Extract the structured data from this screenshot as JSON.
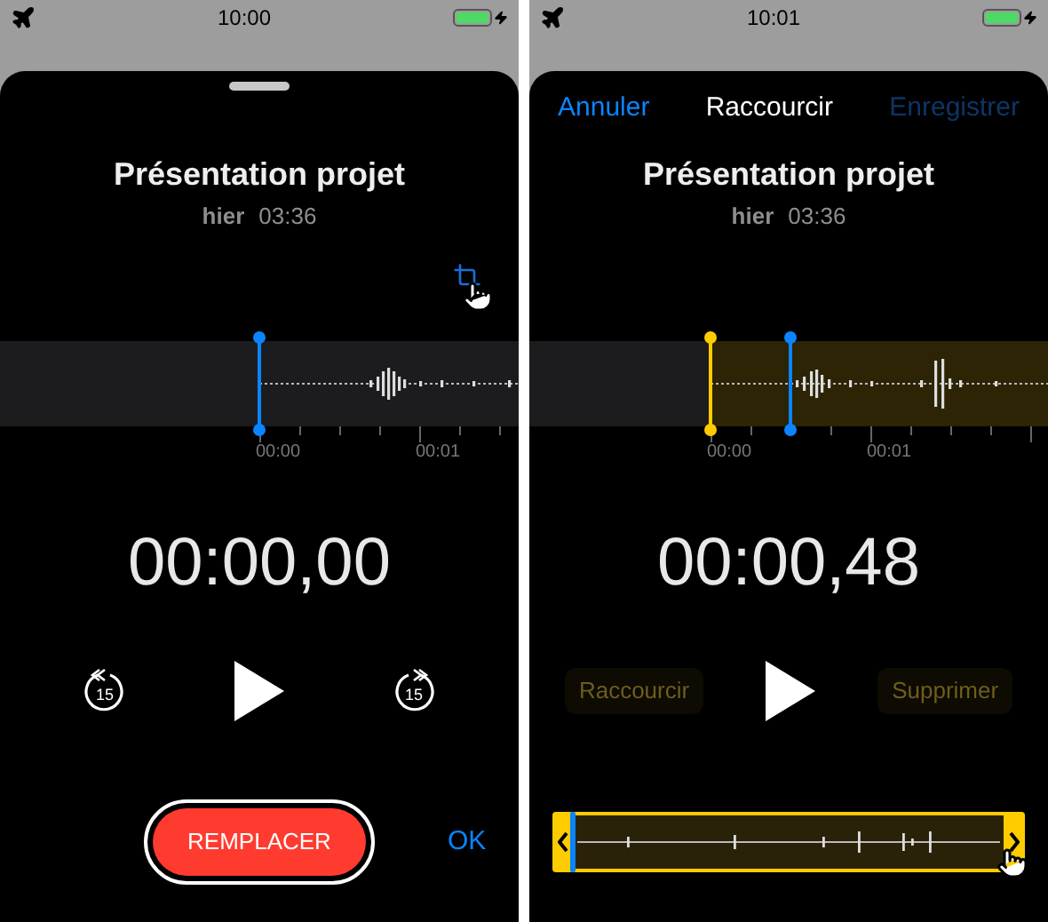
{
  "screens": [
    {
      "kind": "playback",
      "status_bar": {
        "time": "10:00"
      },
      "recording": {
        "title": "Présentation projet",
        "date": "hier",
        "duration": "03:36"
      },
      "timeline": {
        "labels": [
          "00:00",
          "00:01"
        ]
      },
      "timer": "00:00,00",
      "controls": {
        "skip_back": "15",
        "skip_forward": "15"
      },
      "footer": {
        "record_button": "REMPLACER",
        "done": "OK"
      }
    },
    {
      "kind": "trim",
      "status_bar": {
        "time": "10:01"
      },
      "nav": {
        "cancel": "Annuler",
        "title": "Raccourcir",
        "save": {
          "label": "Enregistrer",
          "disabled": true
        }
      },
      "recording": {
        "title": "Présentation projet",
        "date": "hier",
        "duration": "03:36"
      },
      "timeline": {
        "labels": [
          "00:00",
          "00:01"
        ]
      },
      "timer": "00:00,48",
      "actions": [
        {
          "label": "Raccourcir",
          "disabled": true
        },
        {
          "label": "Supprimer",
          "disabled": true
        }
      ]
    }
  ]
}
